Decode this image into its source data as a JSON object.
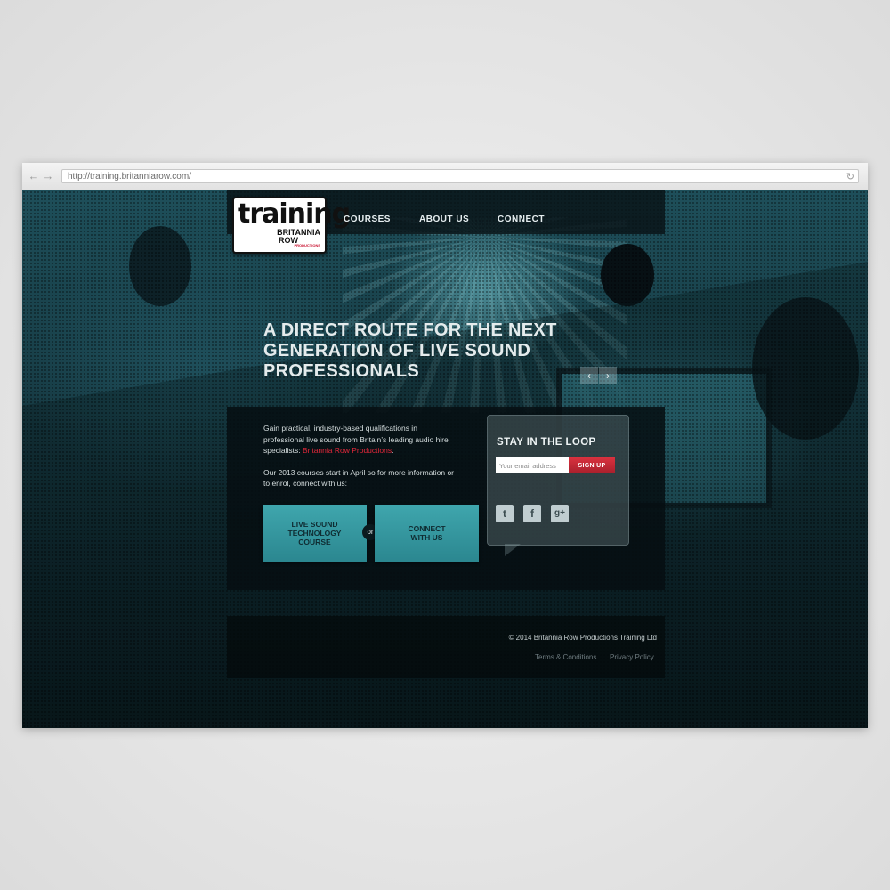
{
  "browser": {
    "url": "http://training.britanniarow.com/",
    "back_glyph": "←",
    "forward_glyph": "→",
    "reload_glyph": "↻"
  },
  "logo": {
    "word": "training",
    "line1": "BRITANNIA",
    "line2": "ROW",
    "tag": "PRODUCTIONS"
  },
  "nav": {
    "items": [
      "COURSES",
      "ABOUT US",
      "CONNECT"
    ]
  },
  "hero": {
    "headline": "A DIRECT ROUTE FOR THE NEXT GENERATION OF LIVE SOUND PROFESSIONALS"
  },
  "slider": {
    "prev_glyph": "‹",
    "next_glyph": "›"
  },
  "intro": {
    "paragraph1_text": "Gain practical, industry-based qualifications in professional live sound from Britain’s leading audio hire specialists: ",
    "paragraph1_link": "Britannia Row Productions",
    "paragraph1_end": ".",
    "paragraph2": "Our 2013 courses start in April so for more information or to enrol, connect with us:"
  },
  "cta": {
    "course_label": "LIVE SOUND\nTECHNOLOGY\nCOURSE",
    "or_label": "or",
    "connect_label": "CONNECT\nWITH US"
  },
  "newsletter": {
    "title": "STAY IN THE LOOP",
    "email_placeholder": "Your email address",
    "signup_label": "SIGN UP"
  },
  "social": {
    "icons": [
      "twitter-icon",
      "facebook-icon",
      "google-plus-icon"
    ],
    "twitter_glyph": "t",
    "facebook_glyph": "f",
    "googleplus_glyph": "g+"
  },
  "footer": {
    "copyright": "© 2014 Britannia Row Productions Training Ltd",
    "terms": "Terms & Conditions",
    "privacy": "Privacy Policy"
  },
  "colors": {
    "accent_teal": "#3fa6ad",
    "link_red": "#e2283a",
    "signup_red": "#c02a36"
  }
}
